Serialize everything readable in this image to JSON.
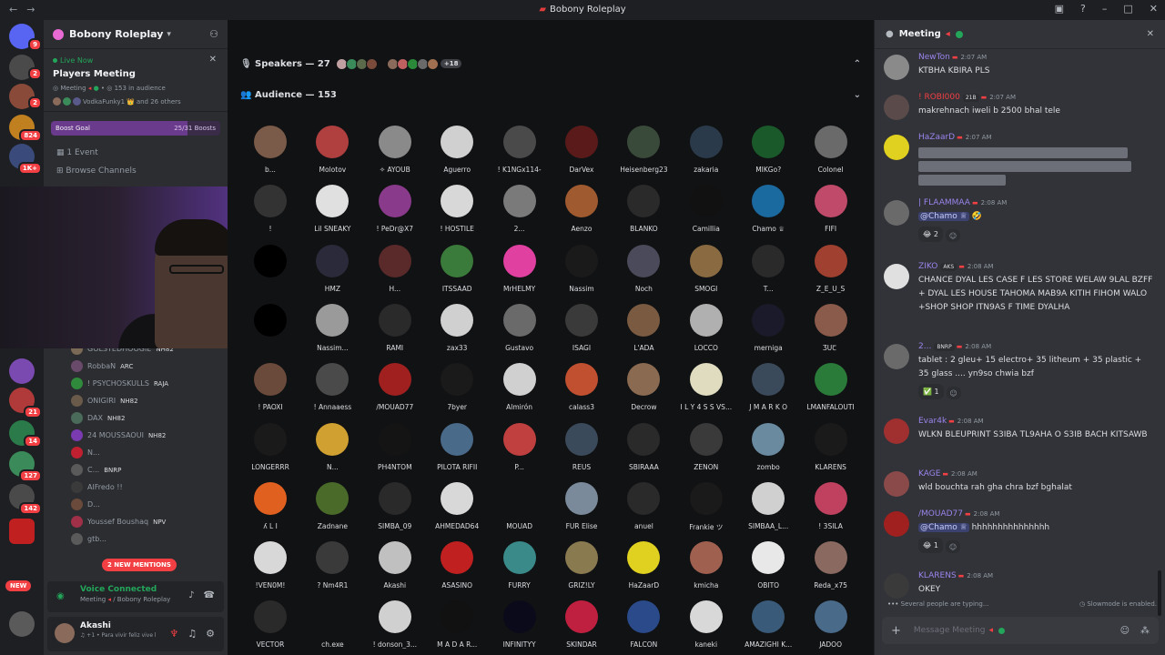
{
  "window": {
    "title": "Bobony Roleplay"
  },
  "rail": {
    "badges": [
      "9",
      "2",
      "2",
      "824",
      "1K+",
      "21",
      "14",
      "127",
      "142"
    ],
    "new_label": "NEW"
  },
  "sidebar": {
    "server_name": "Bobony Roleplay",
    "live": {
      "status": "Live Now",
      "title": "Players Meeting",
      "meta_channel": "Meeting",
      "meta_audience": "153 in audience",
      "host_line": "VodkaFunky1",
      "others": "and 26 others"
    },
    "boost": {
      "label": "Boost Goal",
      "progress": "25/31 Boosts",
      "fraction": 0.806
    },
    "events": "1 Event",
    "browse": "Browse Channels",
    "members": [
      {
        "name": "GOLSTEDHOOGIE",
        "tag": "NH82",
        "color": "#7a6a55"
      },
      {
        "name": "RobbaN",
        "tag": "ARC",
        "color": "#6a4a6a"
      },
      {
        "name": "! PSYCHOSKULLS",
        "tag": "RAJA",
        "color": "#2f8a3c"
      },
      {
        "name": "ONIGIRI",
        "tag": "NH82",
        "color": "#6a5a4a"
      },
      {
        "name": "DAX",
        "tag": "NH82",
        "color": "#4a6a5a"
      },
      {
        "name": "24 MOUSSAOUI",
        "tag": "NH82",
        "color": "#7a3ab0"
      },
      {
        "name": "N...",
        "tag": "",
        "color": "#c02030"
      },
      {
        "name": "C...",
        "tag": "BNRP",
        "color": "#5a5a5a"
      },
      {
        "name": "AlFredo !!",
        "tag": "",
        "color": "#3a3a3a"
      },
      {
        "name": "D...",
        "tag": "",
        "color": "#6a4a3a"
      },
      {
        "name": "Youssef Boushaq",
        "tag": "NPV",
        "color": "#a03048"
      },
      {
        "name": "gtb...",
        "tag": "",
        "color": "#5a5a5a"
      }
    ],
    "mentions": "2 NEW MENTIONS",
    "voice": {
      "status": "Voice Connected",
      "sub": "Meeting",
      "server": "/ Bobony Roleplay"
    },
    "user": {
      "name": "Akashi",
      "status": "♫ +1 • Para vivir feliz vive l"
    }
  },
  "stage": {
    "speakers": {
      "label": "Speakers — 27",
      "more": "+18"
    },
    "audience": {
      "label": "Audience — 153"
    },
    "audience_members": [
      {
        "name": "b...",
        "color": "#7a5a48"
      },
      {
        "name": "Molotov",
        "color": "#b04040"
      },
      {
        "name": "✧ AYOUB",
        "color": "#8a8a8a"
      },
      {
        "name": "Aguerro",
        "color": "#d0d0d0"
      },
      {
        "name": "! K1NGx114-",
        "color": "#4a4a4a"
      },
      {
        "name": "DarVex",
        "color": "#5a1a1a"
      },
      {
        "name": "Heisenberg23",
        "color": "#3a4a3a"
      },
      {
        "name": "zakaria",
        "color": "#2a3a4a"
      },
      {
        "name": "MIKGo?",
        "color": "#1a5a2a"
      },
      {
        "name": "Colonel",
        "color": "#6a6a6a"
      },
      {
        "name": "!",
        "color": "#333333"
      },
      {
        "name": "Lil SNEAKY",
        "color": "#e0e0e0"
      },
      {
        "name": "! PeDr@X7",
        "color": "#8a3a8a"
      },
      {
        "name": "! HOSTILE",
        "color": "#d8d8d8"
      },
      {
        "name": "2...",
        "color": "#7a7a7a"
      },
      {
        "name": "Aenzo",
        "color": "#a05a30"
      },
      {
        "name": "BLANKO",
        "color": "#2a2a2a"
      },
      {
        "name": "Camillia",
        "color": "#111111"
      },
      {
        "name": "Chamo ♕",
        "color": "#1a6aa0"
      },
      {
        "name": "FIFI",
        "color": "#c04a6a"
      },
      {
        "name": "",
        "color": "#000000"
      },
      {
        "name": "HMZ",
        "color": "#2a2a3a"
      },
      {
        "name": "H...",
        "color": "#5a2a2a"
      },
      {
        "name": "ITSSAAD",
        "color": "#3a7a3a"
      },
      {
        "name": "MrHELMY",
        "color": "#e040a0"
      },
      {
        "name": "Nassim",
        "color": "#1a1a1a"
      },
      {
        "name": "Noch",
        "color": "#4a4a5a"
      },
      {
        "name": "SMOGI",
        "color": "#8a6a40"
      },
      {
        "name": "T...",
        "color": "#2a2a2a"
      },
      {
        "name": "Z_E_U_S",
        "color": "#a04030"
      },
      {
        "name": "",
        "color": "#000000"
      },
      {
        "name": "Nassim...",
        "color": "#9a9a9a"
      },
      {
        "name": "RAMI",
        "color": "#2a2a2a"
      },
      {
        "name": "zax33",
        "color": "#d0d0d0"
      },
      {
        "name": "Gustavo",
        "color": "#6a6a6a"
      },
      {
        "name": "ISAGI",
        "color": "#3a3a3a"
      },
      {
        "name": "L'ADA",
        "color": "#7a5a40"
      },
      {
        "name": "LOCCO",
        "color": "#b0b0b0"
      },
      {
        "name": "merniga",
        "color": "#1a1a2a"
      },
      {
        "name": "ƷUꞆ  ",
        "color": "#8a5a4a"
      },
      {
        "name": "! PAOXI",
        "color": "#6a4a3a"
      },
      {
        "name": "! Annaaess",
        "color": "#4a4a4a"
      },
      {
        "name": "/MOUAD77",
        "color": "#a02020"
      },
      {
        "name": "7byer",
        "color": "#1a1a1a"
      },
      {
        "name": "Almirón",
        "color": "#d0d0d0"
      },
      {
        "name": "calass3",
        "color": "#c05030"
      },
      {
        "name": "Decrow",
        "color": "#8a6a50"
      },
      {
        "name": "I L Y 4 S S VS...",
        "color": "#e0dcc0"
      },
      {
        "name": "J M A R K O",
        "color": "#3a4a5a"
      },
      {
        "name": "LMANFALOUTI",
        "color": "#2a7a3a"
      },
      {
        "name": "LONGERRR",
        "color": "#1a1a1a"
      },
      {
        "name": "N...",
        "color": "#d0a030"
      },
      {
        "name": "PH4NTOM",
        "color": "#141414"
      },
      {
        "name": "PILOTA RIFII",
        "color": "#4a6a8a"
      },
      {
        "name": "P...",
        "color": "#c04040"
      },
      {
        "name": "REUS",
        "color": "#3a4a5a"
      },
      {
        "name": "SBIRAAA",
        "color": "#2a2a2a"
      },
      {
        "name": "ZENON",
        "color": "#3a3a3a"
      },
      {
        "name": "zombo",
        "color": "#6a8aa0"
      },
      {
        "name": "KLARENS",
        "color": "#1a1a1a"
      },
      {
        "name": "ʎ L I",
        "color": "#e06020"
      },
      {
        "name": "Zadnane",
        "color": "#4a6a2a"
      },
      {
        "name": "SIMBA_09",
        "color": "#2a2a2a"
      },
      {
        "name": "AHMEDAD64",
        "color": "#d8d8d8"
      },
      {
        "name": "MOUAD",
        "color": "#111214"
      },
      {
        "name": "FUR Elise",
        "color": "#7a8a9a"
      },
      {
        "name": "anuel",
        "color": "#2a2a2a"
      },
      {
        "name": "Frankie ツ",
        "color": "#1a1a1a"
      },
      {
        "name": "SIMBAA_L...",
        "color": "#d0d0d0"
      },
      {
        "name": "! 3SILA",
        "color": "#c04060"
      },
      {
        "name": "!VEN0M!",
        "color": "#d8d8d8"
      },
      {
        "name": "? Nm4R1",
        "color": "#3a3a3a"
      },
      {
        "name": "Akashi",
        "color": "#c0c0c0"
      },
      {
        "name": "ASASINO",
        "color": "#c02020"
      },
      {
        "name": "FURRY",
        "color": "#3a8a8a"
      },
      {
        "name": "GRIZ!LY",
        "color": "#8a7a50"
      },
      {
        "name": "HaZaarD",
        "color": "#e0d020"
      },
      {
        "name": "kmicha",
        "color": "#a06050"
      },
      {
        "name": "OBITO",
        "color": "#e8e8e8"
      },
      {
        "name": "Reda_x75",
        "color": "#8a6a60"
      },
      {
        "name": "VECTOR",
        "color": "#2a2a2a"
      },
      {
        "name": "ch.exe",
        "color": "#111214"
      },
      {
        "name": "! donson_3...",
        "color": "#d0d0d0"
      },
      {
        "name": "M A D A R...",
        "color": "#111111"
      },
      {
        "name": "INFINITYY",
        "color": "#0a0a1a"
      },
      {
        "name": "SKINDAR",
        "color": "#c02040"
      },
      {
        "name": "FALCON",
        "color": "#2a4a8a"
      },
      {
        "name": "kaneki",
        "color": "#d8d8d8"
      },
      {
        "name": "AMAZIGHI K...",
        "color": "#3a5a7a"
      },
      {
        "name": "JADOO",
        "color": "#4a6a8a"
      }
    ]
  },
  "chat": {
    "title": "Meeting",
    "messages": [
      {
        "author": "NewTon",
        "color": "#9b84ec",
        "time": "2:07 AM",
        "tag": "",
        "body": "KTBHA KBIRA PLS",
        "av": "#8a8a8a"
      },
      {
        "author": "! ROBI000",
        "color": "#f23f43",
        "time": "2:07 AM",
        "tag": "21B",
        "body": "makrehnach iweli b 2500 bhal tele",
        "av": "#5a4a4a"
      },
      {
        "author": "HaZaarD",
        "color": "#9b84ec",
        "time": "2:07 AM",
        "tag": "",
        "body": "",
        "av": "#e0d020"
      },
      {
        "author": "| FLAAMMAA",
        "color": "#9b84ec",
        "time": "2:08 AM",
        "tag": "",
        "body": "@Chamo ♕ 🤣",
        "av": "#6a6a6a",
        "react": "😂 2"
      },
      {
        "author": "ZIKO",
        "color": "#9b84ec",
        "time": "2:08 AM",
        "tag": "AKS",
        "body": "CHANCE DYAL LES CASE F LES STORE WELAW 9LAL BZFF + DYAL LES HOUSE TAHOMA MAB9A KITIH FIHOM WALO +SHOP SHOP ITN9AS F TIME DYALHA",
        "av": "#e0e0e0"
      },
      {
        "author": "2...",
        "color": "#9b84ec",
        "time": "2:08 AM",
        "tag": "BNRP",
        "body": "tablet : 2 gleu+ 15 electro+ 35 litheum + 35 plastic + 35 glass .... yn9so chwia bzf",
        "av": "#6a6a6a",
        "react": "✅ 1"
      },
      {
        "author": "Evar4k",
        "color": "#9b84ec",
        "time": "2:08 AM",
        "tag": "",
        "body": "WLKN BLEUPRINT S3IBA TL9AHA O S3IB BACH KITSAWB",
        "av": "#a03030"
      },
      {
        "author": "KAGE",
        "color": "#9b84ec",
        "time": "2:08 AM",
        "tag": "",
        "body": "wld bouchta rah gha chra bzf bghalat",
        "av": "#8a4a4a"
      },
      {
        "author": "/MOUAD77",
        "color": "#9b84ec",
        "time": "2:08 AM",
        "tag": "",
        "body": "@Chamo ♕ hhhhhhhhhhhhhhh",
        "av": "#a02020",
        "react": "😂 1"
      },
      {
        "author": "KLARENS",
        "color": "#9b84ec",
        "time": "2:08 AM",
        "tag": "",
        "body": "OKEY",
        "av": "#3a3a3a"
      }
    ],
    "typing": "Several people are typing...",
    "slowmode": "Slowmode is enabled.",
    "placeholder": "Message Meeting"
  }
}
